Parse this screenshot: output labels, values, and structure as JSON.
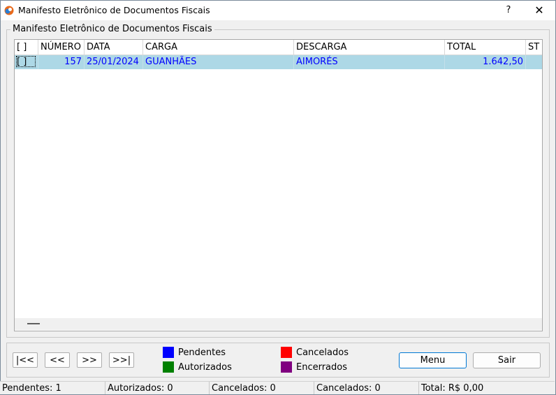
{
  "window": {
    "title": "Manifesto Eletrônico de Documentos Fiscais",
    "help": "?",
    "close": "✕"
  },
  "group": {
    "title": "Manifesto Eletrônico de Documentos Fiscais"
  },
  "table": {
    "columns": [
      "[ ]",
      "NÚMERO",
      "DATA",
      "CARGA",
      "DESCARGA",
      "TOTAL",
      "ST"
    ],
    "rows": [
      {
        "check": "[ ]",
        "numero": "157",
        "data": "25/01/2024",
        "carga": "GUANHÃES",
        "descarga": "AIMORÉS",
        "total": "1.642,50",
        "st": ""
      }
    ]
  },
  "nav": {
    "first": "|<<",
    "prev": "<<",
    "next": ">>",
    "last": ">>|"
  },
  "legend": [
    {
      "label": "Pendentes",
      "color": "#0000ff"
    },
    {
      "label": "Autorizados",
      "color": "#008000"
    },
    {
      "label": "Cancelados",
      "color": "#ff0000"
    },
    {
      "label": "Encerrados",
      "color": "#800080"
    }
  ],
  "buttons": {
    "menu": "Menu",
    "sair": "Sair"
  },
  "status": {
    "pendentes": "Pendentes: 1",
    "autorizados": "Autorizados: 0",
    "cancelados1": "Cancelados: 0",
    "cancelados2": "Cancelados: 0",
    "total": "Total: R$ 0,00"
  }
}
